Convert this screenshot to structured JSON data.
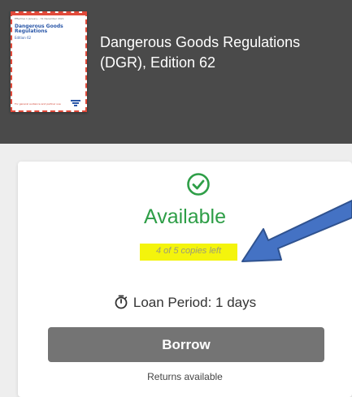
{
  "book": {
    "title": "Dangerous Goods Regulations (DGR), Edition 62",
    "cover": {
      "header_text": "Effective 1 January – 31 December 2021",
      "title": "Dangerous Goods Regulations",
      "subtitle": "Edition 62",
      "footer_text": "For general audience and partner use",
      "logo": "iata-logo-icon"
    }
  },
  "availability": {
    "status": "Available",
    "copies_left": "4 of 5 copies left",
    "status_icon": "check-circle-icon",
    "highlight_color": "#f4f40c",
    "status_color": "#2e9e47"
  },
  "loan": {
    "label": "Loan Period: 1 days",
    "icon": "stopwatch-icon"
  },
  "actions": {
    "borrow_label": "Borrow",
    "returns_text": "Returns available"
  },
  "annotation": {
    "arrow_color": "#4472c4"
  }
}
